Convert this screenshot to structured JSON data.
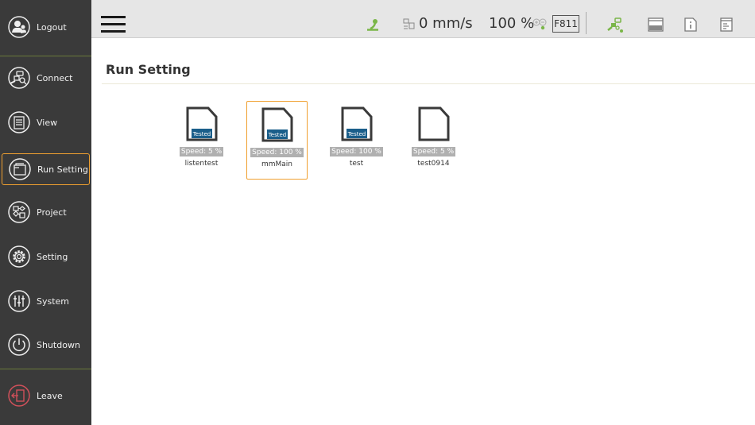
{
  "sidebar": {
    "items": [
      {
        "label": "Logout",
        "icon": "logout-icon"
      },
      {
        "label": "Connect",
        "icon": "connect-icon"
      },
      {
        "label": "View",
        "icon": "view-icon"
      },
      {
        "label": "Run Setting",
        "icon": "run-setting-icon",
        "active": true
      },
      {
        "label": "Project",
        "icon": "project-icon"
      },
      {
        "label": "Setting",
        "icon": "gear-icon"
      },
      {
        "label": "System",
        "icon": "system-sliders-icon"
      },
      {
        "label": "Shutdown",
        "icon": "power-icon"
      },
      {
        "label": "Leave",
        "icon": "leave-icon"
      }
    ]
  },
  "header": {
    "speed": "0 mm/s",
    "percent": "100 %",
    "function_code": "F811"
  },
  "main": {
    "title": "Run Setting",
    "files": [
      {
        "name": "listentest",
        "speed": "Speed: 5 %",
        "badge": "Tested"
      },
      {
        "name": "mmMain",
        "speed": "Speed: 100 %",
        "badge": "Tested",
        "selected": true
      },
      {
        "name": "test",
        "speed": "Speed: 100 %",
        "badge": "Tested"
      },
      {
        "name": "test0914",
        "speed": "Speed: 5 %",
        "badge": null
      }
    ]
  },
  "colors": {
    "sidebar_bg": "#3a3a3a",
    "accent_selected": "#f0a030",
    "status_green": "#7ab648",
    "badge_blue": "#1a5e8a",
    "leave_red": "#d0505a"
  }
}
